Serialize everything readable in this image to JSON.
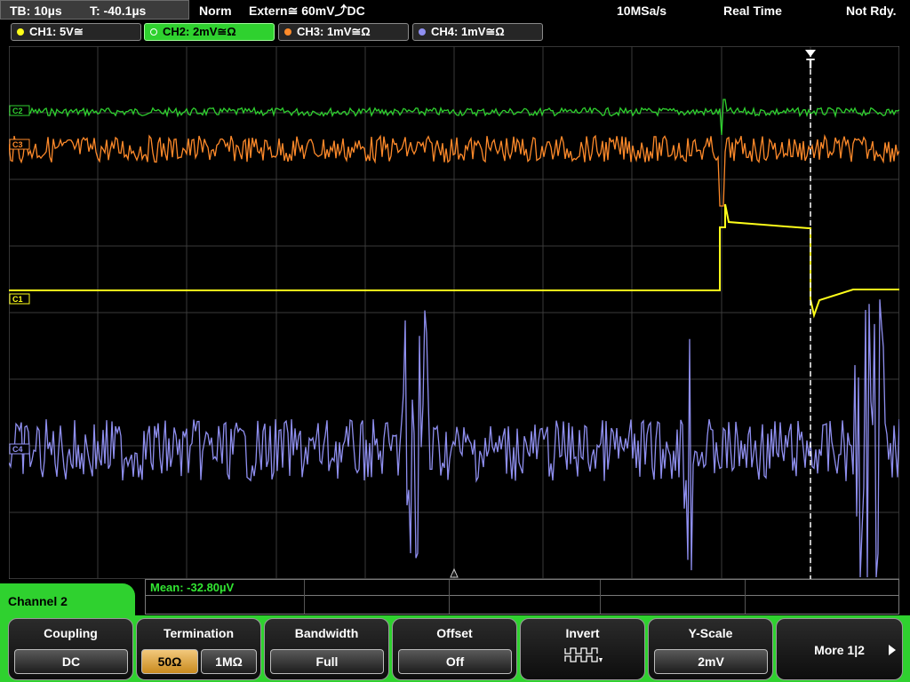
{
  "status": {
    "timebase": "TB: 10µs",
    "trigger_time": "T: -40.1µs",
    "mode": "Norm",
    "trigger": "Extern≅ 60mV⤴DC",
    "sample_rate": "10MSa/s",
    "acq": "Real Time",
    "ready": "Not Rdy."
  },
  "channels": [
    {
      "label": "CH1: 5V≅",
      "color": "#ffff1a"
    },
    {
      "label": "CH2: 2mV≅Ω",
      "color": "#2fd12f",
      "active": true
    },
    {
      "label": "CH3: 1mV≅Ω",
      "color": "#ff8a2a"
    },
    {
      "label": "CH4: 1mV≅Ω",
      "color": "#8f8ff0"
    }
  ],
  "markers": {
    "ch1": "C1",
    "ch2": "C2",
    "ch3": "C3",
    "ch4": "C4"
  },
  "measurement": "Mean: -32.80µV",
  "menu": {
    "channel_tab": "Channel 2",
    "coupling": {
      "title": "Coupling",
      "value": "DC"
    },
    "termination": {
      "title": "Termination",
      "opt1": "50Ω",
      "opt2": "1MΩ"
    },
    "bandwidth": {
      "title": "Bandwidth",
      "value": "Full"
    },
    "offset": {
      "title": "Offset",
      "value": "Off"
    },
    "invert": {
      "title": "Invert"
    },
    "yscale": {
      "title": "Y-Scale",
      "value": "2mV"
    },
    "more": "More 1|2"
  },
  "colors": {
    "grid": "#3a3a3a",
    "ch1": "#ffff1a",
    "ch2": "#2fd12f",
    "ch3": "#ff8a2a",
    "ch4": "#8f8ff0"
  }
}
